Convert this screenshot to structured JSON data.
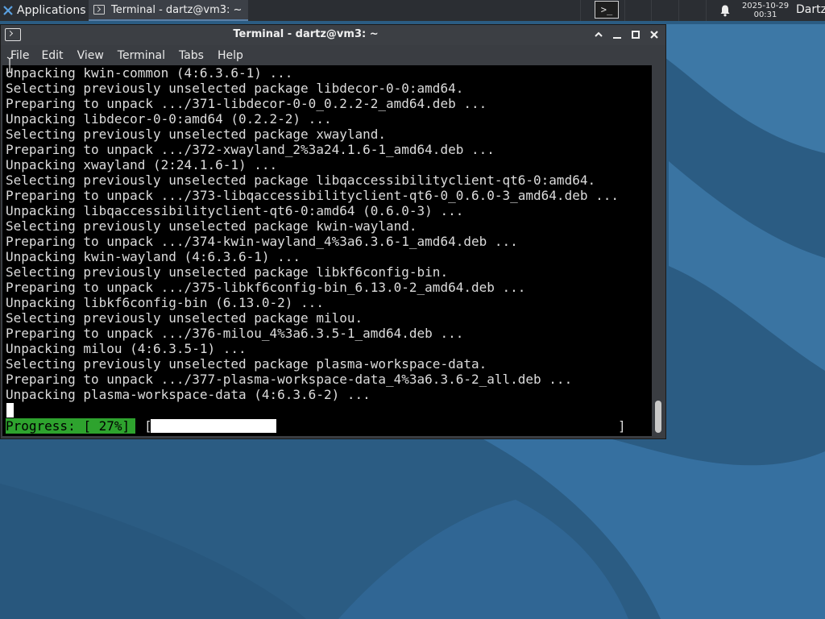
{
  "panel": {
    "apps_label": "Applications",
    "apps_sep": "☰",
    "task_title": "Terminal - dartz@vm3: ~",
    "clock_date": "2025-10-29",
    "clock_time": "00:31",
    "user": "Dartz",
    "icons": [
      "xfce-logo-icon",
      "terminal-icon",
      "terminal-launcher-icon",
      "bell-icon"
    ]
  },
  "window": {
    "title": "Terminal - dartz@vm3: ~",
    "buttons": [
      "chevron-up-icon",
      "minimize-icon",
      "maximize-icon",
      "close-icon"
    ],
    "menu": [
      "File",
      "Edit",
      "View",
      "Terminal",
      "Tabs",
      "Help"
    ]
  },
  "terminal": {
    "lines": [
      "Unpacking kwin-common (4:6.3.6-1) ...",
      "Selecting previously unselected package libdecor-0-0:amd64.",
      "Preparing to unpack .../371-libdecor-0-0_0.2.2-2_amd64.deb ...",
      "Unpacking libdecor-0-0:amd64 (0.2.2-2) ...",
      "Selecting previously unselected package xwayland.",
      "Preparing to unpack .../372-xwayland_2%3a24.1.6-1_amd64.deb ...",
      "Unpacking xwayland (2:24.1.6-1) ...",
      "Selecting previously unselected package libqaccessibilityclient-qt6-0:amd64.",
      "Preparing to unpack .../373-libqaccessibilityclient-qt6-0_0.6.0-3_amd64.deb ...",
      "Unpacking libqaccessibilityclient-qt6-0:amd64 (0.6.0-3) ...",
      "Selecting previously unselected package kwin-wayland.",
      "Preparing to unpack .../374-kwin-wayland_4%3a6.3.6-1_amd64.deb ...",
      "Unpacking kwin-wayland (4:6.3.6-1) ...",
      "Selecting previously unselected package libkf6config-bin.",
      "Preparing to unpack .../375-libkf6config-bin_6.13.0-2_amd64.deb ...",
      "Unpacking libkf6config-bin (6.13.0-2) ...",
      "Selecting previously unselected package milou.",
      "Preparing to unpack .../376-milou_4%3a6.3.5-1_amd64.deb ...",
      "Unpacking milou (4:6.3.5-1) ...",
      "Selecting previously unselected package plasma-workspace-data.",
      "Preparing to unpack .../377-plasma-workspace-data_4%3a6.3.6-2_all.deb ...",
      "Unpacking plasma-workspace-data (4:6.3.6-2) ..."
    ],
    "progress_label": "Progress: [ 27%]",
    "progress_open": "[",
    "progress_close": "]",
    "progress_fraction": 0.27
  },
  "colors": {
    "progress_green": "#2ea32e",
    "terminal_bg": "#000000",
    "terminal_fg": "#dcdcdc",
    "wallpaper": "#2d5f85"
  }
}
